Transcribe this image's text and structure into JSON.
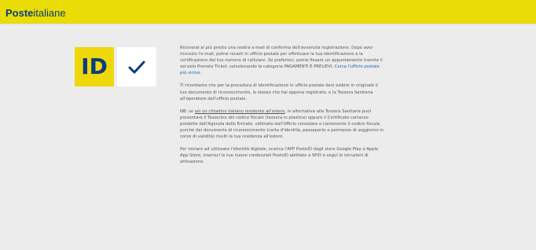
{
  "header": {
    "logo_bold": "Poste",
    "logo_light": "italiane",
    "background": "#eadc05"
  },
  "badges": {
    "id_label": "ID",
    "check_icon": "checkmark-icon",
    "id_bg": "#efd80a",
    "id_text_color": "#0b3d7c"
  },
  "content": {
    "p1_text": "Riceverai al più presto una nostra e-mail di conferma dell'avvenuta registrazione. Dopo aver ricevuto l'e-mail, potrai recarti in ufficio postale per effettuare la tua identificazione e la certificazione del tuo numero di cellulare. Se preferisci, potrai fissare un appuntamento tramite il servizio Prenota Ticket, selezionando la categoria PAGAMENTI E PRELIEVI. ",
    "p1_link": "Cerca l'ufficio postale più vicino.",
    "p2_text": "Ti ricordiamo che per la procedura di identificazione in ufficio postale devi esibire in originale il tuo documento di riconoscimento, lo stesso che hai appena registrato, e la Tessera Sanitaria all'operatore dell'ufficio postale.",
    "p3_prefix": "NB: se ",
    "p3_underline": "sei un cittadino italiano residente all'estero",
    "p3_text": ", in alternativa alla Tessera Sanitaria puoi presentare il Tesserino del codice fiscale (tessera in plastica) oppure il Certificato cartaceo prodotto dall'Agenzia delle Entrate, vidimato dall'Ufficio consolare e contenente il codice fiscale, purché dal documento di riconoscimento (carta d'identità, passaporto o permesso di soggiorno in corso di validità) risulti la tua residenza all'estero.",
    "p4_text": "Per iniziare ad utilizzare l'identità digitale, scarica l'APP PosteID dagli store Google Play o Apple App Store, inserisci le tue nuove credenziali PosteID abilitato a SPID e segui le istruzioni di attivazione."
  }
}
